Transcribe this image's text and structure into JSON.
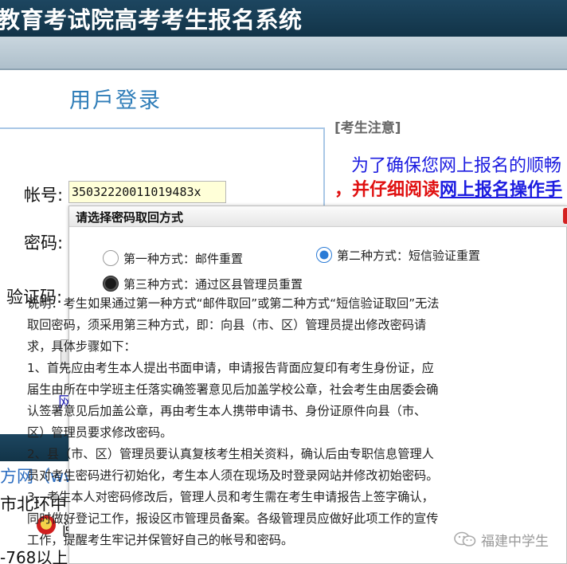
{
  "header": {
    "title": "教育考试院高考考生报名系统"
  },
  "login": {
    "heading": "用戶登录",
    "account_label": "帐号:",
    "account_value": "35032220011019483x",
    "password_label": "密码:",
    "captcha_label": "验证码:",
    "link_fragment": "网"
  },
  "notice": {
    "heading": "[考生注意]",
    "line1": "为了确保您网上报名的顺畅",
    "line2_prefix": "，并仔细阅读",
    "line2_link": "网上报名操作手"
  },
  "footer": {
    "link_fragment": "方网（ww",
    "address_fragment": "市北环中",
    "clip_fragment": "闽",
    "phone_fragment": "-768以上"
  },
  "dialog": {
    "title": "请选择密码取回方式",
    "options": [
      {
        "label": "第一种方式：邮件重置",
        "state": "unselected"
      },
      {
        "label": "第二种方式：短信验证重置",
        "state": "selected"
      },
      {
        "label": "第三种方式：通过区县管理员重置",
        "state": "selected"
      }
    ],
    "description_lines": [
      "说明：考生如果通过第一种方式“邮件取回”或第二种方式“短信验证取回”无法",
      "取回密码，须采用第三种方式，即：向县（市、区）管理员提出修改密码请",
      "求，具体步骤如下：",
      "1、首先应由考生本人提出书面申请，申请报告背面应复印有考生身份证，应",
      "届生由所在中学班主任落实确签署意见后加盖学校公章，社会考生由居委会确",
      "认签署意见后加盖公章，再由考生本人携带申请书、身份证原件向县（市、",
      "区）管理员要求修改密码。",
      "2、县（市、区）管理员要认真复核考生相关资料，确认后由专职信息管理人",
      "员对考生密码进行初始化，考生本人须在现场及时登录网站并修改初始密码。",
      "3、考生本人对密码修改后，管理人员和考生需在考生申请报告上签字确认，",
      "同时做好登记工作，报设区市管理员备案。各级管理员应做好此项工作的宣传",
      "工作，提醒考生牢记并保管好自己的帐号和密码。"
    ]
  },
  "watermark": {
    "text": "福建中学生"
  }
}
